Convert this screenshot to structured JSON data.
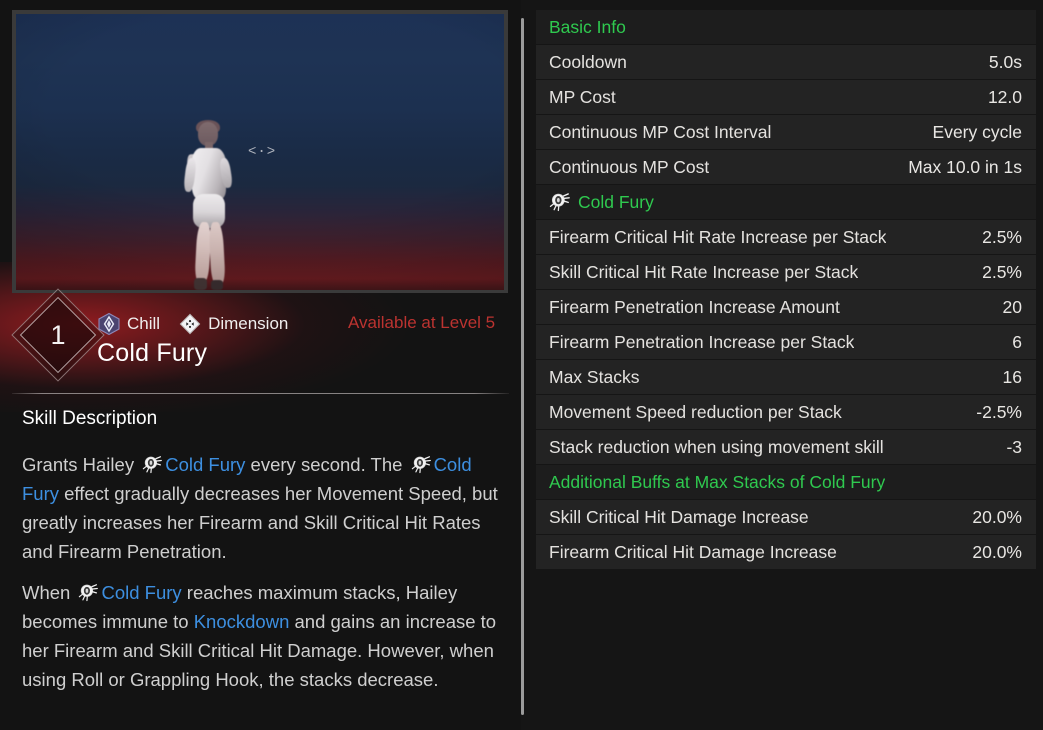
{
  "preview": {
    "reticle_glyph": "<·>",
    "character_name": "Hailey"
  },
  "skill": {
    "level_badge": "1",
    "name": "Cold Fury",
    "availability": "Available at Level 5",
    "tags": [
      {
        "label": "Chill",
        "icon": "chill-icon"
      },
      {
        "label": "Dimension",
        "icon": "dimension-icon"
      }
    ]
  },
  "description": {
    "heading": "Skill Description",
    "paragraphs": [
      {
        "parts": [
          {
            "type": "text",
            "text": "Grants Hailey "
          },
          {
            "type": "icon",
            "icon": "cold-fury-icon"
          },
          {
            "type": "keyword",
            "text": "Cold Fury"
          },
          {
            "type": "text",
            "text": " every second. The "
          },
          {
            "type": "icon",
            "icon": "cold-fury-icon"
          },
          {
            "type": "keyword",
            "text": "Cold Fury"
          },
          {
            "type": "text",
            "text": " effect gradually decreases her Movement Speed, but greatly increases her Firearm and Skill Critical Hit Rates and Firearm Penetration."
          }
        ]
      },
      {
        "parts": [
          {
            "type": "text",
            "text": "When "
          },
          {
            "type": "icon",
            "icon": "cold-fury-icon"
          },
          {
            "type": "keyword",
            "text": "Cold Fury"
          },
          {
            "type": "text",
            "text": " reaches maximum stacks, Hailey becomes immune to "
          },
          {
            "type": "keyword",
            "text": "Knockdown"
          },
          {
            "type": "text",
            "text": " and gains an increase to her Firearm and Skill Critical Hit Damage. However, when using Roll or Grappling Hook, the stacks decrease."
          }
        ]
      }
    ]
  },
  "stats": [
    {
      "type": "section",
      "label": "Basic Info",
      "icon": null
    },
    {
      "type": "row",
      "label": "Cooldown",
      "value": "5.0s"
    },
    {
      "type": "row",
      "label": "MP Cost",
      "value": "12.0"
    },
    {
      "type": "row",
      "label": "Continuous MP Cost Interval",
      "value": "Every cycle"
    },
    {
      "type": "row",
      "label": "Continuous MP Cost",
      "value": "Max 10.0 in 1s"
    },
    {
      "type": "section",
      "label": "Cold Fury",
      "icon": "cold-fury-icon"
    },
    {
      "type": "row",
      "label": "Firearm Critical Hit Rate Increase per Stack",
      "value": "2.5%"
    },
    {
      "type": "row",
      "label": "Skill Critical Hit Rate Increase per Stack",
      "value": "2.5%"
    },
    {
      "type": "row",
      "label": "Firearm Penetration Increase Amount",
      "value": "20"
    },
    {
      "type": "row",
      "label": "Firearm Penetration Increase per Stack",
      "value": "6"
    },
    {
      "type": "row",
      "label": "Max Stacks",
      "value": "16"
    },
    {
      "type": "row",
      "label": "Movement Speed reduction per Stack",
      "value": "-2.5%"
    },
    {
      "type": "row",
      "label": "Stack reduction when using movement skill",
      "value": "-3"
    },
    {
      "type": "section",
      "label": "Additional Buffs at Max Stacks of Cold Fury",
      "icon": null
    },
    {
      "type": "row",
      "label": "Skill Critical Hit Damage Increase",
      "value": "20.0%"
    },
    {
      "type": "row",
      "label": "Firearm Critical Hit Damage Increase",
      "value": "20.0%"
    }
  ],
  "colors": {
    "section_green": "#2fc94f",
    "keyword_blue": "#3d8fe0",
    "availability_red": "#bc3330",
    "row_bg": "#232323",
    "section_bg": "#1d1d1d"
  }
}
